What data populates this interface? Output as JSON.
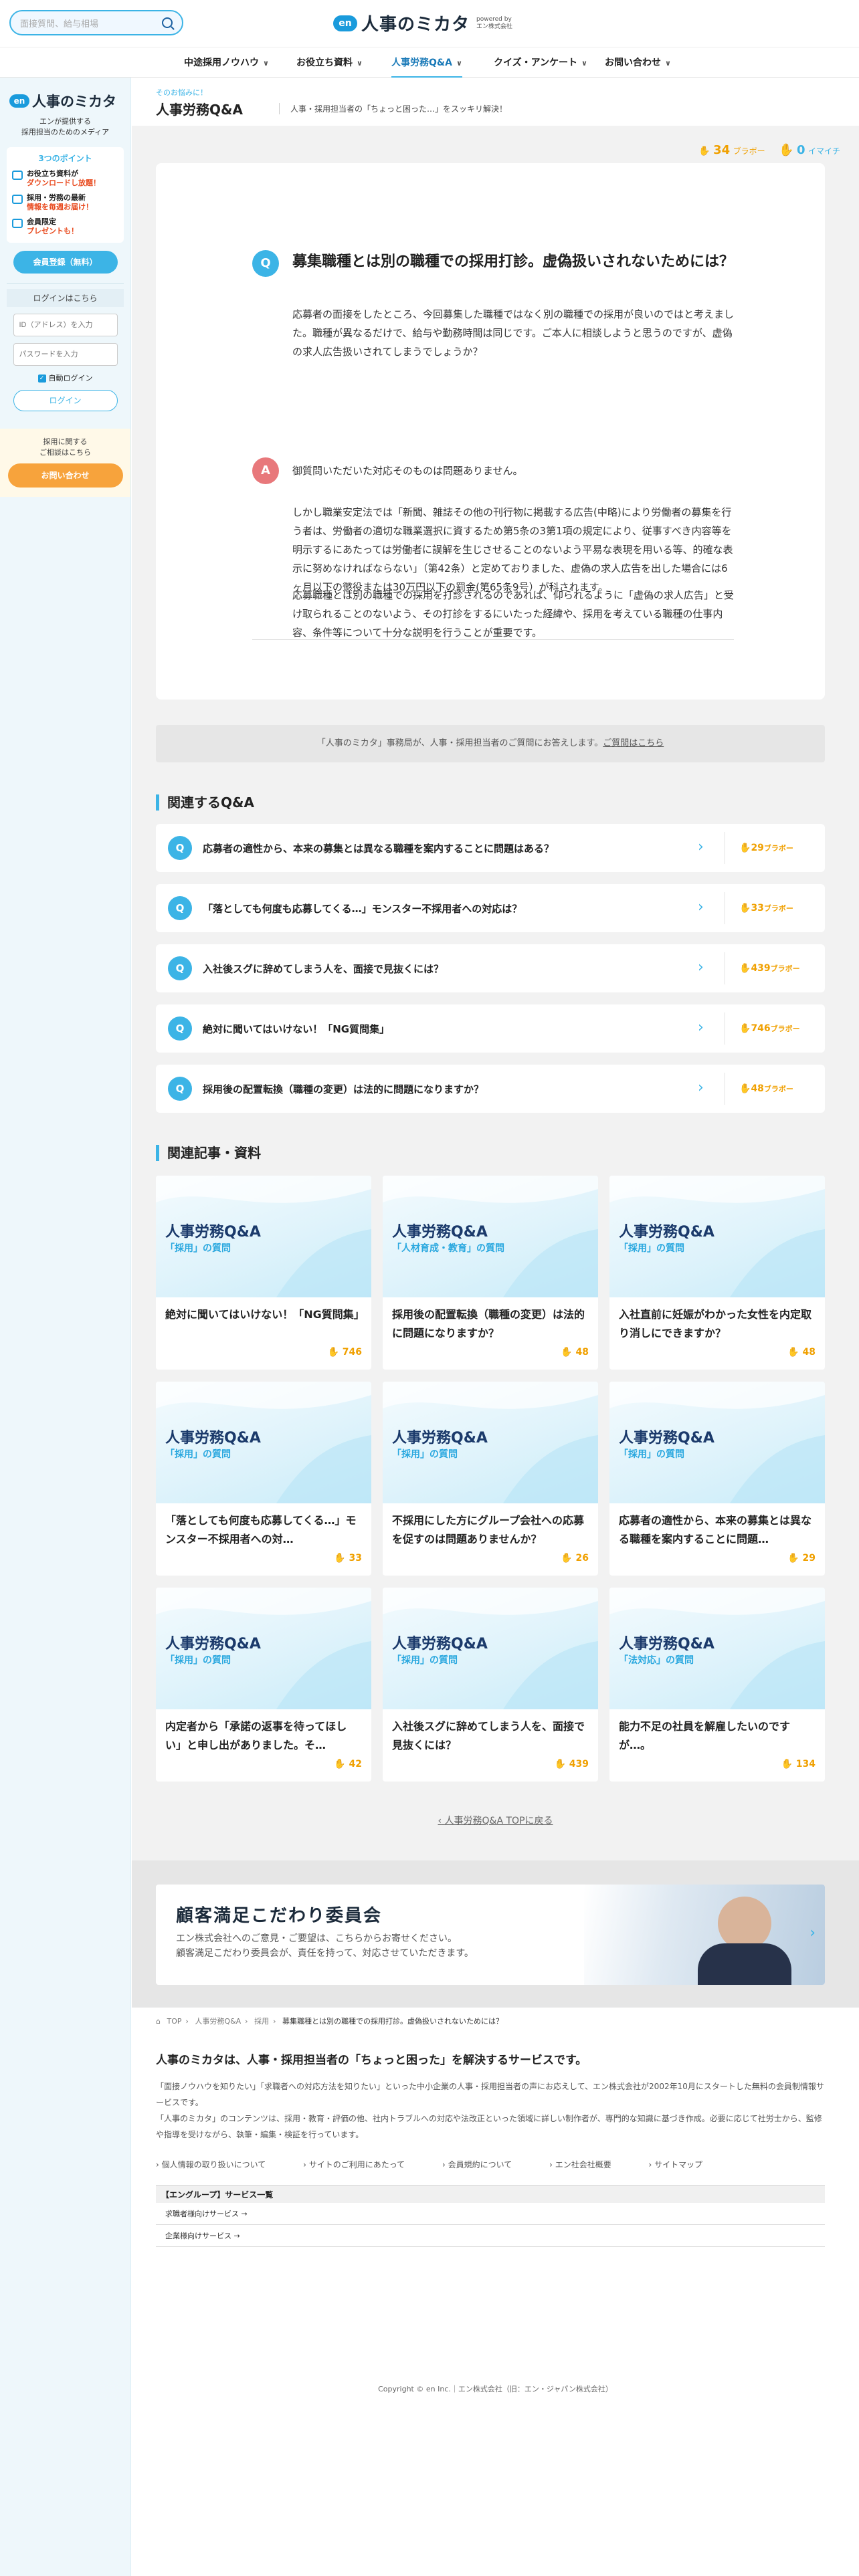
{
  "header": {
    "search_placeholder": "面接質問、給与相場",
    "logo_mark": "en",
    "logo_name": "人事のミカタ",
    "powered_line1": "powered by",
    "powered_line2": "エン株式会社"
  },
  "nav": [
    {
      "label": "中途採用ノウハウ"
    },
    {
      "label": "お役立ち資料"
    },
    {
      "label": "人事労務Q&A"
    },
    {
      "label": "クイズ・アンケート"
    },
    {
      "label": "お問い合わせ"
    }
  ],
  "sidebar": {
    "logo_mark": "en",
    "logo_name": "人事のミカタ",
    "tagline_1": "エンが提供する",
    "tagline_2": "採用担当のためのメディア",
    "points_title": "3つのポイント",
    "points": [
      {
        "pre": "お役立ち資料が",
        "hl": "ダウンロードし放題！"
      },
      {
        "pre": "採用・労務の最新",
        "hl": "情報を毎週お届け！"
      },
      {
        "pre": "会員限定",
        "hl": "プレゼントも！"
      }
    ],
    "register_label": "会員登録（無料）",
    "login_title": "ログインはこちら",
    "email_placeholder": "ID（アドレス）を入力",
    "password_placeholder": "パスワードを入力",
    "auto_login": "自動ログイン",
    "login_button": "ログイン",
    "contact_1": "採用に関する",
    "contact_2": "ご相談はこちら",
    "contact_button": "お問い合わせ"
  },
  "page": {
    "category": "そのお悩みに！",
    "title": "人事労務Q&A",
    "subtitle": "人事・採用担当者の「ちょっと困った…」をスッキリ解決！",
    "likes_count": "34",
    "likes_label": "ブラボー",
    "hmm_count": "0",
    "hmm_label": "イマイチ"
  },
  "qa": {
    "q_badge": "Q",
    "question_title": "募集職種とは別の職種での採用打診。虚偽扱いされないためには？",
    "question_body": "応募者の面接をしたところ、今回募集した職種ではなく別の職種での採用が良いのではと考えました。職種が異なるだけで、給与や勤務時間は同じです。ご本人に相談しようと思うのですが、虚偽の求人広告扱いされてしまうでしょうか？",
    "a_badge": "A",
    "answer_1": "御質問いただいた対応そのものは問題ありません。",
    "answer_2": "しかし職業安定法では「新聞、雑誌その他の刊行物に掲載する広告(中略)により労働者の募集を行う者は、労働者の適切な職業選択に資するため第5条の3第1項の規定により、従事すべき内容等を明示するにあたっては労働者に誤解を生じさせることのないよう平易な表現を用いる等、的確な表示に努めなければならない」（第42条）と定めておりました、虚偽の求人広告を出した場合には6ヶ月以下の懲役または30万円以下の罰金(第65条9号）が科されます。",
    "answer_3": "応募職種とは別の職種での採用を打診されるのであれば、仰られるように「虚偽の求人広告」と受け取られることのないよう、その打診をするにいたった経緯や、採用を考えている職種の仕事内容、条件等について十分な説明を行うことが重要です。"
  },
  "note": {
    "text": "「人事のミカタ」事務局が、人事・採用担当者のご質問にお答えします。",
    "link": "ご質問はこちら"
  },
  "related_qa": {
    "heading": "関連するQ&A",
    "items": [
      {
        "title": "応募者の適性から、本来の募集とは異なる職種を案内することに問題はある？",
        "likes": "29",
        "unit": "ブラボー"
      },
      {
        "title": "「落としても何度も応募してくる…」モンスター不採用者への対応は？",
        "likes": "33",
        "unit": "ブラボー"
      },
      {
        "title": "入社後スグに辞めてしまう人を、面接で見抜くには？",
        "likes": "439",
        "unit": "ブラボー"
      },
      {
        "title": "絶対に聞いてはいけない！「NG質問集」",
        "likes": "746",
        "unit": "ブラボー"
      },
      {
        "title": "採用後の配置転換（職種の変更）は法的に問題になりますか？",
        "likes": "48",
        "unit": "ブラボー"
      }
    ]
  },
  "related_articles": {
    "heading": "関連記事・資料",
    "items": [
      {
        "cat": "人事労務Q&A",
        "sub": "「採用」の質問",
        "title": "絶対に聞いてはいけない！「NG質問集」",
        "likes": "746"
      },
      {
        "cat": "人事労務Q&A",
        "sub": "「人材育成・教育」の質問",
        "title": "採用後の配置転換（職種の変更）は法的に問題になりますか？",
        "likes": "48"
      },
      {
        "cat": "人事労務Q&A",
        "sub": "「採用」の質問",
        "title": "入社直前に妊娠がわかった女性を内定取り消しにできますか？",
        "likes": "48"
      },
      {
        "cat": "人事労務Q&A",
        "sub": "「採用」の質問",
        "title": "「落としても何度も応募してくる…」モンスター不採用者への対…",
        "likes": "33"
      },
      {
        "cat": "人事労務Q&A",
        "sub": "「採用」の質問",
        "title": "不採用にした方にグループ会社への応募を促すのは問題ありませんか？",
        "likes": "26"
      },
      {
        "cat": "人事労務Q&A",
        "sub": "「採用」の質問",
        "title": "応募者の適性から、本来の募集とは異なる職種を案内することに問題…",
        "likes": "29"
      },
      {
        "cat": "人事労務Q&A",
        "sub": "「採用」の質問",
        "title": "内定者から「承諾の返事を待ってほしい」と申し出がありました。そ…",
        "likes": "42"
      },
      {
        "cat": "人事労務Q&A",
        "sub": "「採用」の質問",
        "title": "入社後スグに辞めてしまう人を、面接で見抜くには？",
        "likes": "439"
      },
      {
        "cat": "人事労務Q&A",
        "sub": "「法対応」の質問",
        "title": "能力不足の社員を解雇したいのですが…。",
        "likes": "134"
      }
    ]
  },
  "back_link": "人事労務Q&A TOPに戻る",
  "banner": {
    "title": "顧客満足こだわり委員会",
    "line1": "エン株式会社へのご意見・ご要望は、こちらからお寄せください。",
    "line2": "顧客満足こだわり委員会が、責任を持って、対応させていただきます。"
  },
  "footer": {
    "breadcrumb": [
      "TOP",
      "人事労務Q&A",
      "採用",
      "募集職種とは別の職種での採用打診。虚偽扱いされないためには？"
    ],
    "title": "人事のミカタは、人事・採用担当者の「ちょっと困った」を解決するサービスです。",
    "desc1": "「面接ノウハウを知りたい」「求職者への対応方法を知りたい」といった中小企業の人事・採用担当者の声にお応えして、エン株式会社が2002年10月にスタートした無料の会員制情報サービスです。",
    "desc2": "「人事のミカタ」のコンテンツは、採用・教育・評価の他、社内トラブルへの対応や法改正といった領域に詳しい制作者が、専門的な知識に基づき作成。必要に応じて社労士から、監修や指導を受けながら、執筆・編集・検証を行っています。",
    "links": [
      "個人情報の取り扱いについて",
      "サイトのご利用にあたって",
      "会員規約について",
      "エン社会社概要",
      "サイトマップ"
    ],
    "svc_heading": "【エングループ】サービス一覧",
    "svc_rows": [
      "求職者様向けサービス",
      "企業様向けサービス"
    ],
    "copyright": "Copyright © en Inc.｜エン株式会社（旧：エン・ジャパン株式会社）"
  }
}
